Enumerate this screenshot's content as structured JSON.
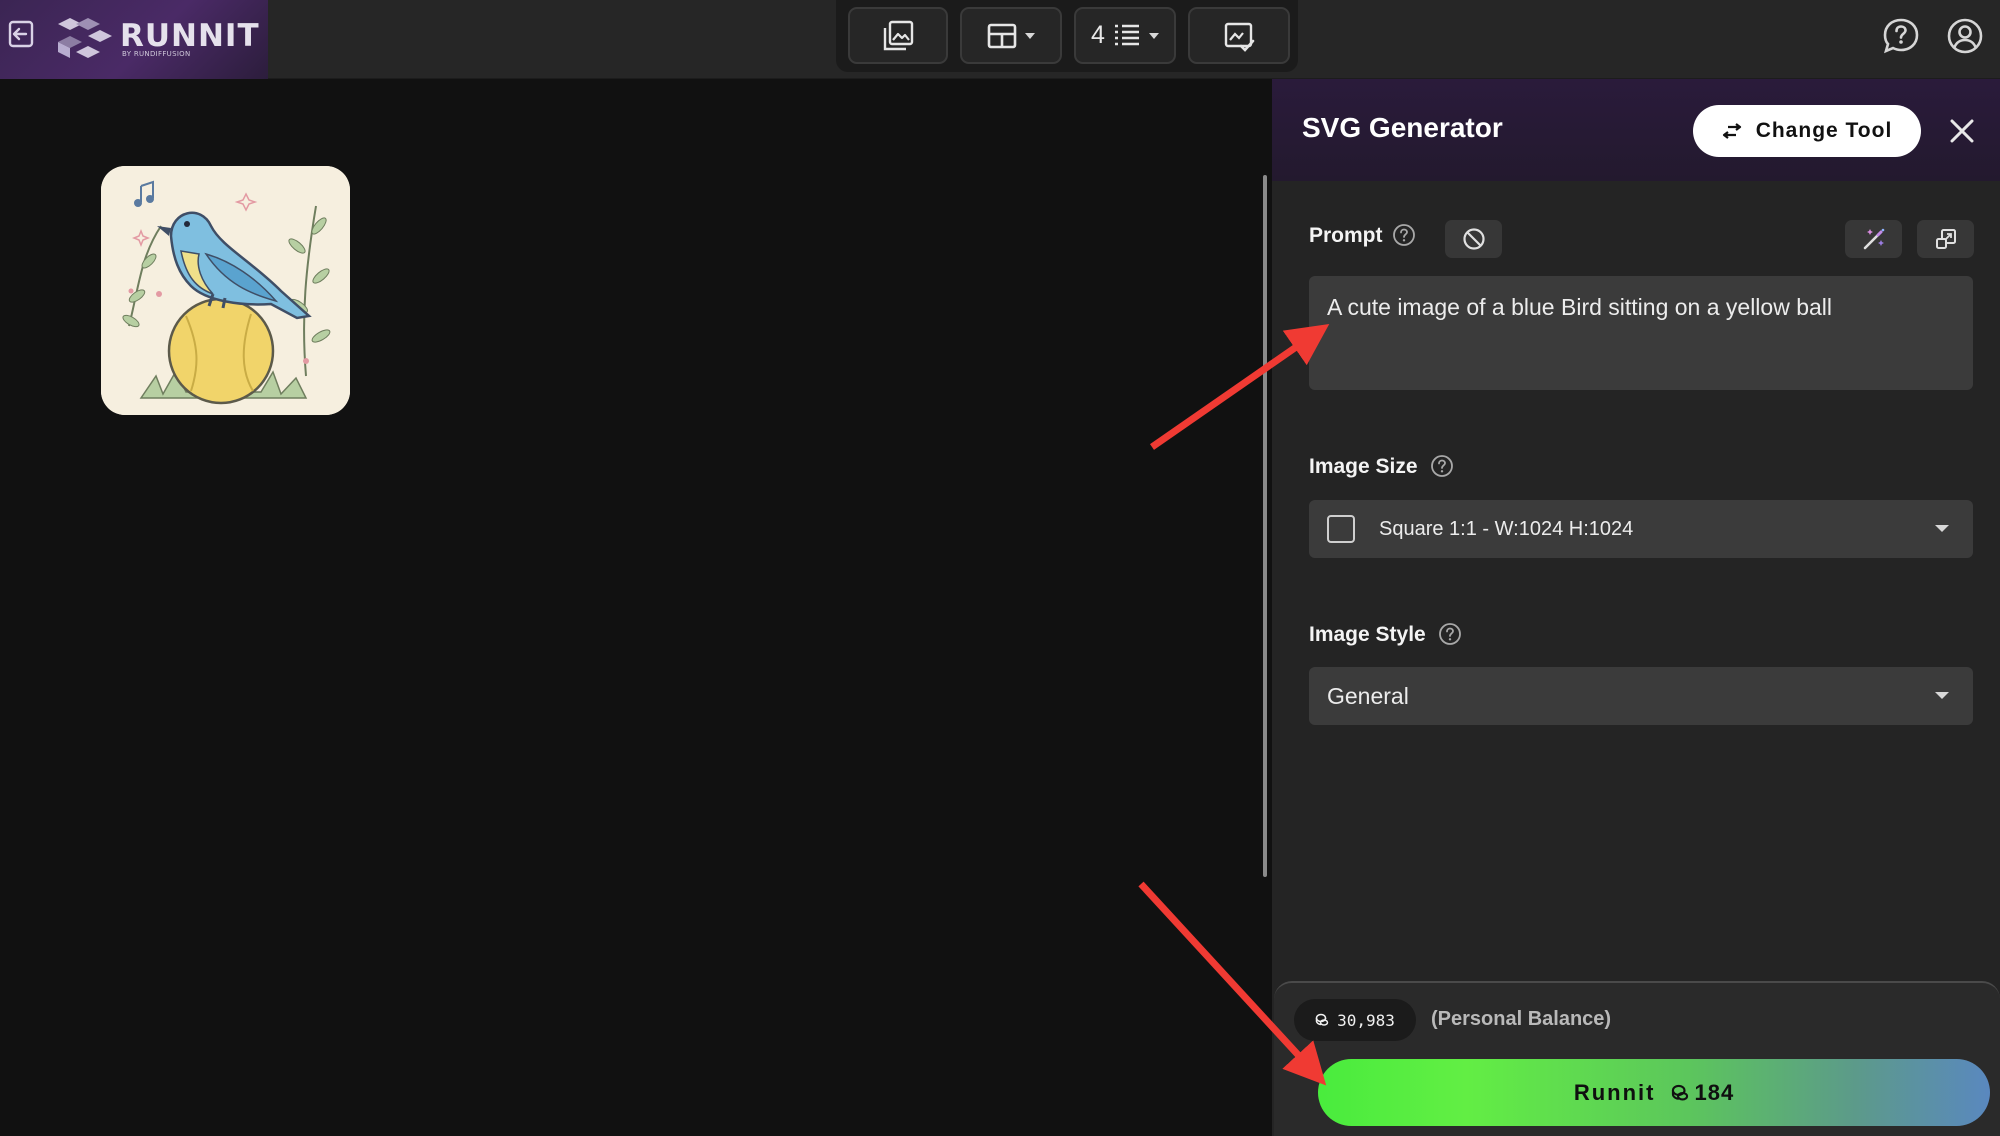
{
  "brand": {
    "name": "RUNNIT",
    "tagline": "BY RUNDIFFUSION"
  },
  "toolbar": {
    "output_count": "4"
  },
  "panel": {
    "title": "SVG Generator",
    "change_tool_label": "Change Tool",
    "prompt": {
      "label": "Prompt",
      "value": "A cute image of a blue Bird sitting on a yellow ball"
    },
    "image_size": {
      "label": "Image Size",
      "selected": "Square 1:1 - W:1024 H:1024"
    },
    "image_style": {
      "label": "Image Style",
      "selected": "General"
    }
  },
  "footer": {
    "balance": "30,983",
    "balance_label": "(Personal Balance)",
    "run_label": "Runnit",
    "run_cost": "184"
  },
  "colors": {
    "accent_green": "#49ec3d",
    "accent_blue": "#5a88bf",
    "header_purple": "#2a1b3b",
    "annotation_red": "#f03a33"
  },
  "icons": [
    "exit-icon",
    "gallery-icon",
    "layout-grid-icon",
    "list-icon",
    "image-check-icon",
    "help-icon",
    "account-icon",
    "swap-icon",
    "close-icon",
    "clear-icon",
    "magic-wand-icon",
    "expand-icon",
    "credit-coin-icon"
  ]
}
